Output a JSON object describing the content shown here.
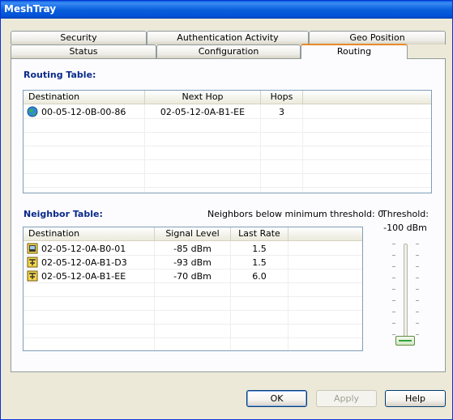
{
  "window": {
    "title": "MeshTray"
  },
  "tabs": {
    "row1": [
      "Security",
      "Authentication Activity",
      "Geo Position"
    ],
    "row2": [
      "Status",
      "Configuration",
      "Routing"
    ],
    "active": "Routing"
  },
  "routing_table": {
    "title": "Routing Table:",
    "columns": [
      "Destination",
      "Next Hop",
      "Hops"
    ],
    "rows": [
      {
        "icon": "globe-icon",
        "destination": "00-05-12-0B-00-86",
        "next_hop": "02-05-12-0A-B1-EE",
        "hops": "3"
      }
    ]
  },
  "neighbor_table": {
    "title": "Neighbor Table:",
    "status": "Neighbors below minimum threshold: 0",
    "columns": [
      "Destination",
      "Signal Level",
      "Last Rate"
    ],
    "rows": [
      {
        "icon": "device-icon",
        "destination": "02-05-12-0A-B0-01",
        "signal": "-85 dBm",
        "rate": "1.5"
      },
      {
        "icon": "router-icon",
        "destination": "02-05-12-0A-B1-D3",
        "signal": "-93 dBm",
        "rate": "1.5"
      },
      {
        "icon": "router-icon",
        "destination": "02-05-12-0A-B1-EE",
        "signal": "-70 dBm",
        "rate": "6.0"
      }
    ]
  },
  "threshold": {
    "label": "Threshold:",
    "value": "-100 dBm",
    "level_fraction": 0.0
  },
  "buttons": {
    "ok": "OK",
    "apply": "Apply",
    "help": "Help"
  }
}
